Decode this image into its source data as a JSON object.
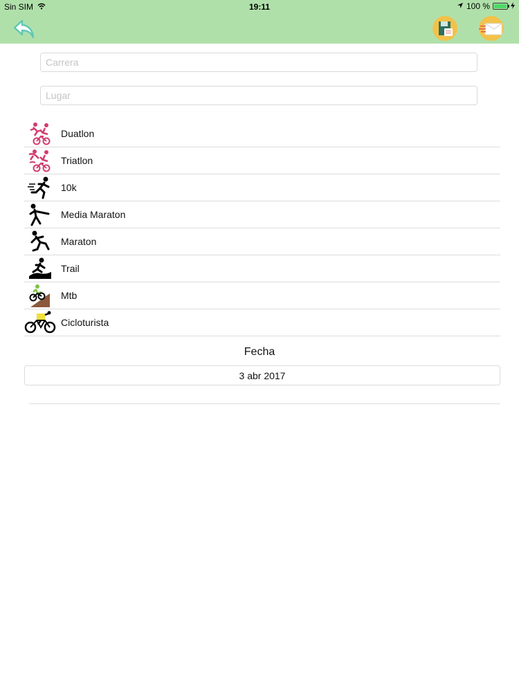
{
  "status_bar": {
    "carrier": "Sin SIM",
    "time": "19:11",
    "battery": "100 %"
  },
  "nav": {
    "back_icon": "back-arrow-icon",
    "save_icon": "save-document-icon",
    "send_icon": "send-envelope-icon"
  },
  "form": {
    "carrera_placeholder": "Carrera",
    "lugar_placeholder": "Lugar",
    "carrera_value": "",
    "lugar_value": ""
  },
  "race_types": [
    {
      "label": "Duatlon",
      "icon": "duathlon-icon"
    },
    {
      "label": "Triatlon",
      "icon": "triathlon-icon"
    },
    {
      "label": "10k",
      "icon": "runner-icon"
    },
    {
      "label": "Media Maraton",
      "icon": "half-marathon-runner-icon"
    },
    {
      "label": "Maraton",
      "icon": "marathon-runner-icon"
    },
    {
      "label": "Trail",
      "icon": "trail-runner-icon"
    },
    {
      "label": "Mtb",
      "icon": "mountain-bike-icon"
    },
    {
      "label": "Cicloturista",
      "icon": "road-bike-icon"
    }
  ],
  "date": {
    "label": "Fecha",
    "value": "3 abr 2017"
  },
  "colors": {
    "nav_bar": "#b0e0aa",
    "back_arrow": "#5ec8b3",
    "tri_icon": "#d23c6e",
    "nav_button": "#f2c24a",
    "battery": "#4cd964"
  }
}
